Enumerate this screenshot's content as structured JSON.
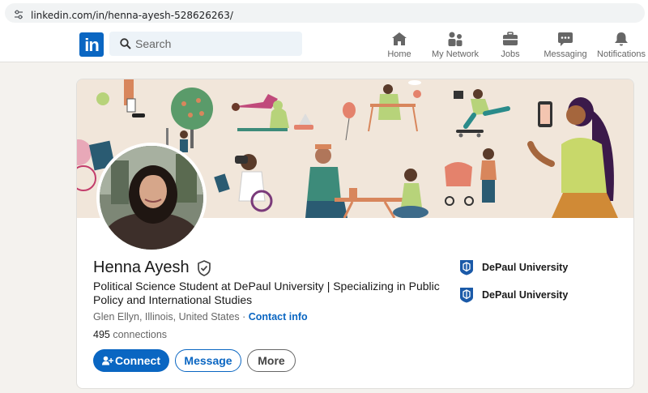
{
  "browser": {
    "url": "linkedin.com/in/henna-ayesh-528626263/"
  },
  "nav": {
    "logo_text": "in",
    "search_placeholder": "Search",
    "items": [
      {
        "label": "Home",
        "icon": "home-icon"
      },
      {
        "label": "My Network",
        "icon": "network-icon"
      },
      {
        "label": "Jobs",
        "icon": "briefcase-icon"
      },
      {
        "label": "Messaging",
        "icon": "messaging-icon"
      },
      {
        "label": "Notifications",
        "icon": "bell-icon"
      }
    ]
  },
  "profile": {
    "name": "Henna Ayesh",
    "headline": "Political Science Student at DePaul University | Specializing in Public Policy and International Studies",
    "location": "Glen Ellyn, Illinois, United States",
    "separator": " · ",
    "contact_label": "Contact info",
    "connections_count": "495",
    "connections_label": "connections",
    "buttons": {
      "connect": "Connect",
      "message": "Message",
      "more": "More"
    },
    "education": [
      {
        "name": "DePaul University"
      },
      {
        "name": "DePaul University"
      }
    ]
  },
  "colors": {
    "brand": "#0a66c2",
    "banner_bg": "#f1e6da",
    "page_bg": "#f4f2ee"
  }
}
